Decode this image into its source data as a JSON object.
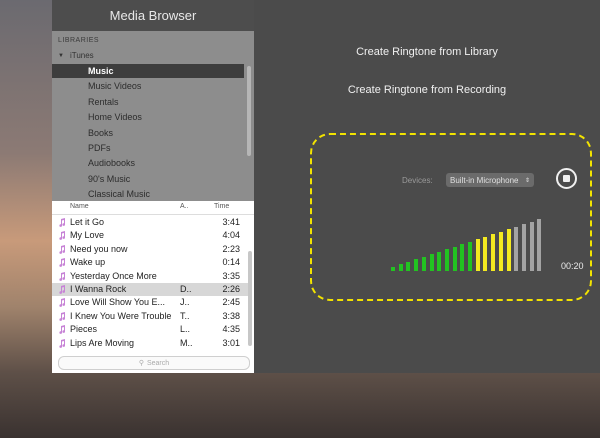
{
  "media_browser": {
    "title": "Media Browser",
    "libraries_header": "LIBRARIES",
    "itunes_label": "iTunes",
    "sources": [
      {
        "label": "Music",
        "selected": true
      },
      {
        "label": "Music Videos",
        "selected": false
      },
      {
        "label": "Rentals",
        "selected": false
      },
      {
        "label": "Home Videos",
        "selected": false
      },
      {
        "label": "Books",
        "selected": false
      },
      {
        "label": "PDFs",
        "selected": false
      },
      {
        "label": "Audiobooks",
        "selected": false
      },
      {
        "label": "90's Music",
        "selected": false
      },
      {
        "label": "Classical Music",
        "selected": false
      }
    ],
    "columns": {
      "name": "Name",
      "artist": "A..",
      "time": "Time"
    },
    "songs": [
      {
        "name": "Let it Go",
        "artist": "",
        "time": "3:41"
      },
      {
        "name": "My Love",
        "artist": "",
        "time": "4:04"
      },
      {
        "name": "Need you now",
        "artist": "",
        "time": "2:23"
      },
      {
        "name": "Wake up",
        "artist": "",
        "time": "0:14"
      },
      {
        "name": "Yesterday Once More",
        "artist": "",
        "time": "3:35"
      },
      {
        "name": "I Wanna Rock",
        "artist": "D..",
        "time": "2:26",
        "selected": true
      },
      {
        "name": "Love Will Show You E...",
        "artist": "J..",
        "time": "2:45"
      },
      {
        "name": "I Knew You Were Trouble",
        "artist": "T..",
        "time": "3:38"
      },
      {
        "name": "Pieces",
        "artist": "L..",
        "time": "4:35"
      },
      {
        "name": "Lips Are Moving",
        "artist": "M..",
        "time": "3:01"
      }
    ],
    "search_placeholder": "Search"
  },
  "recorder": {
    "create_from_library": "Create Ringtone from Library",
    "create_from_recording": "Create Ringtone from Recording",
    "devices_label": "Devices:",
    "device_value": "Built-in Microphone",
    "timer": "00:20",
    "level_segments": 20,
    "level_active": 16,
    "colors": {
      "green": "#22c321",
      "yellow": "#f4ea20",
      "grey": "#a3a3a3",
      "dash": "#f2e300"
    }
  }
}
